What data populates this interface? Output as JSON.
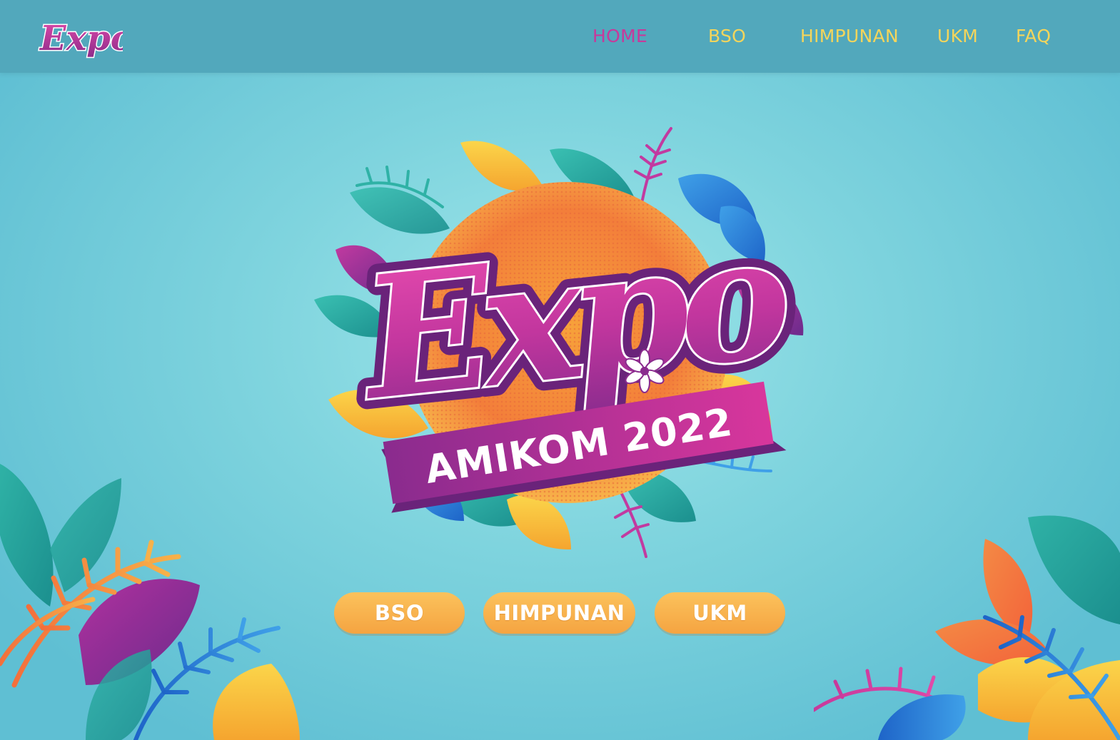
{
  "brand": {
    "logo_text": "Expo",
    "pink": "#c8399b",
    "purple": "#7a2b86",
    "yellow": "#f4d55b",
    "orange": "#f5a441",
    "teal": "#52a8bc"
  },
  "nav": {
    "items": [
      {
        "label": "HOME",
        "active": true
      },
      {
        "label": "BSO",
        "active": false
      },
      {
        "label": "HIMPUNAN",
        "active": false
      },
      {
        "label": "UKM",
        "active": false
      },
      {
        "label": "FAQ",
        "active": false
      }
    ]
  },
  "hero": {
    "logo_text": "Expo",
    "banner_text": "AMIKOM 2022"
  },
  "cta": {
    "buttons": [
      {
        "label": "BSO"
      },
      {
        "label": "HIMPUNAN"
      },
      {
        "label": "UKM"
      }
    ]
  }
}
